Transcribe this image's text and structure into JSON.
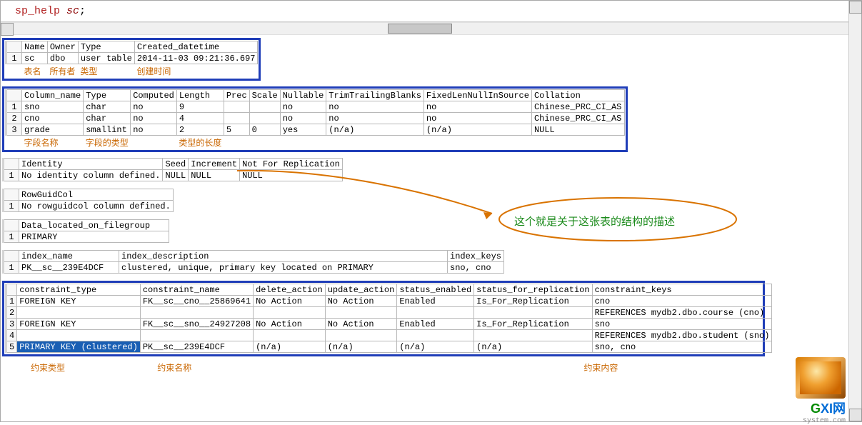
{
  "sql": {
    "cmd": "sp_help",
    "arg": "sc",
    "semi": ";"
  },
  "t1": {
    "head": [
      "Name",
      "Owner",
      "Type",
      "Created_datetime"
    ],
    "row": [
      "sc",
      "dbo",
      "user table",
      "2014-11-03 09:21:36.697"
    ],
    "annot": [
      "表名",
      "所有者",
      "类型",
      "创建时间"
    ]
  },
  "t2": {
    "head": [
      "Column_name",
      "Type",
      "Computed",
      "Length",
      "Prec",
      "Scale",
      "Nullable",
      "TrimTrailingBlanks",
      "FixedLenNullInSource",
      "Collation"
    ],
    "rows": [
      [
        "sno",
        "char",
        "no",
        "9",
        " ",
        "",
        "no",
        "no",
        "no",
        "Chinese_PRC_CI_AS"
      ],
      [
        "cno",
        "char",
        "no",
        "4",
        " ",
        "",
        "no",
        "no",
        "no",
        "Chinese_PRC_CI_AS"
      ],
      [
        "grade",
        "smallint",
        "no",
        "2",
        "5",
        "0",
        "yes",
        "(n/a)",
        "(n/a)",
        "NULL"
      ]
    ],
    "annot": [
      "字段名称",
      "字段的类型",
      "",
      "类型的长度",
      "",
      "",
      "",
      "",
      "",
      ""
    ]
  },
  "t3": {
    "head": [
      "Identity",
      "Seed",
      "Increment",
      "Not For Replication"
    ],
    "row": [
      "No identity column defined.",
      "NULL",
      "NULL",
      "NULL"
    ]
  },
  "t4": {
    "head": [
      "RowGuidCol"
    ],
    "row": [
      "No rowguidcol column defined."
    ]
  },
  "t5": {
    "head": [
      "Data_located_on_filegroup"
    ],
    "row": [
      "PRIMARY"
    ]
  },
  "t6": {
    "head": [
      "index_name",
      "index_description",
      "index_keys"
    ],
    "row": [
      "PK__sc__239E4DCF",
      "clustered, unique, primary key located on PRIMARY",
      "sno, cno"
    ]
  },
  "t7": {
    "head": [
      "constraint_type",
      "constraint_name",
      "delete_action",
      "update_action",
      "status_enabled",
      "status_for_replication",
      "constraint_keys"
    ],
    "rows": [
      [
        "FOREIGN KEY",
        "FK__sc__cno__25869641",
        "No Action",
        "No Action",
        "Enabled",
        "Is_For_Replication",
        "cno"
      ],
      [
        " ",
        " ",
        " ",
        " ",
        " ",
        " ",
        "REFERENCES mydb2.dbo.course (cno)"
      ],
      [
        "FOREIGN KEY",
        "FK__sc__sno__24927208",
        "No Action",
        "No Action",
        "Enabled",
        "Is_For_Replication",
        "sno"
      ],
      [
        " ",
        " ",
        " ",
        " ",
        " ",
        " ",
        "REFERENCES mydb2.dbo.student (sno)"
      ],
      [
        "PRIMARY KEY (clustered)",
        "PK__sc__239E4DCF",
        "(n/a)",
        "(n/a)",
        "(n/a)",
        "(n/a)",
        "sno, cno"
      ]
    ],
    "annot": {
      "c0": "约束类型",
      "c1": "约束名称",
      "c6": "约束内容"
    }
  },
  "green": "这个就是关于这张表的结构的描述",
  "logo": {
    "big": "GXI网",
    "small": "system.com"
  }
}
